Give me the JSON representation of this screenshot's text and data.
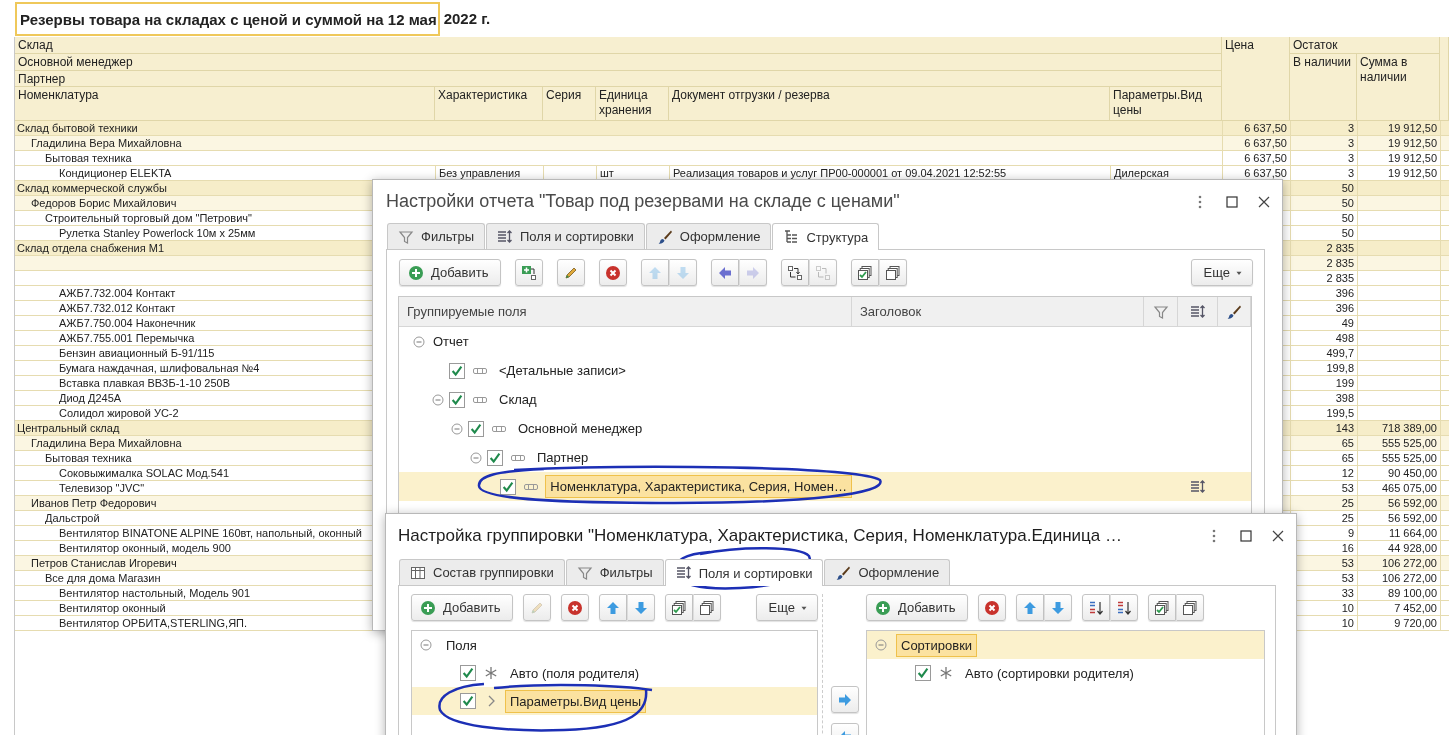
{
  "report": {
    "title_cell": "Резервы товара на складах с ценой и суммой на 12 мая",
    "title_rest": "2022 г.",
    "header": {
      "groupings": [
        "Склад",
        "Основной менеджер",
        "Партнер"
      ],
      "columns": [
        "Номенклатура",
        "Характеристика",
        "Серия",
        "Единица хранения",
        "Документ отгрузки / резерва",
        "Параметры.Вид цены"
      ],
      "price": "Цена",
      "balance": "Остаток",
      "balance_columns": [
        "В наличии",
        "Сумма в наличии"
      ]
    },
    "rows": [
      {
        "name": "Склад бытовой техники",
        "price": "6 637,50",
        "in_stock": "3",
        "sum": "19 912,50",
        "children": [
          {
            "name": "Гладилина Вера Михайловна",
            "price": "6 637,50",
            "in_stock": "3",
            "sum": "19 912,50",
            "children": [
              {
                "name": "Бытовая техника",
                "price": "6 637,50",
                "in_stock": "3",
                "sum": "19 912,50",
                "children": [
                  {
                    "name": "Кондиционер ELEKTA",
                    "characteristic": "Без управления",
                    "unit": "шт",
                    "document": "Реализация товаров и услуг ПР00-000001 от 09.04.2021 12:52:55",
                    "price_type": "Дилерская",
                    "price": "6 637,50",
                    "in_stock": "3",
                    "sum": "19 912,50"
                  }
                ]
              }
            ]
          }
        ]
      },
      {
        "name": "Склад коммерческой службы",
        "in_stock": "50",
        "children": [
          {
            "name": "Федоров Борис Михайлович",
            "in_stock": "50",
            "children": [
              {
                "name": "Строительный торговый дом \"Петрович\"",
                "in_stock": "50",
                "children": [
                  {
                    "name": "Рулетка Stanley Powerlock 10м x 25мм",
                    "in_stock": "50"
                  }
                ]
              }
            ]
          }
        ]
      },
      {
        "name": "Склад отдела снабжения М1",
        "in_stock": "2 835",
        "children": [
          {
            "in_stock": "2 835",
            "children": [
              {
                "in_stock": "2 835",
                "children": [
                  {
                    "name": "АЖБ7.732.004 Контакт",
                    "in_stock": "396"
                  },
                  {
                    "name": "АЖБ7.732.012 Контакт",
                    "in_stock": "396"
                  },
                  {
                    "name": "АЖБ7.750.004 Наконечник",
                    "in_stock": "49"
                  },
                  {
                    "name": "АЖБ7.755.001 Перемычка",
                    "in_stock": "498"
                  },
                  {
                    "name": "Бензин авиационный Б-91/115",
                    "in_stock": "499,7"
                  },
                  {
                    "name": "Бумага наждачная, шлифовальная №4",
                    "in_stock": "199,8"
                  },
                  {
                    "name": "Вставка плавкая ВВЗБ-1-10 250В",
                    "in_stock": "199"
                  },
                  {
                    "name": "Диод Д245А",
                    "in_stock": "398"
                  },
                  {
                    "name": "Солидол жировой УС-2",
                    "in_stock": "199,5"
                  }
                ]
              }
            ]
          }
        ]
      },
      {
        "name": "Центральный склад",
        "in_stock": "143",
        "sum": "718 389,00",
        "children": [
          {
            "name": "Гладилина Вера Михайловна",
            "in_stock": "65",
            "sum": "555 525,00",
            "children": [
              {
                "name": "Бытовая техника",
                "in_stock": "65",
                "sum": "555 525,00",
                "children": [
                  {
                    "name": "Соковыжималка  SOLAC  Мод.541",
                    "in_stock": "12",
                    "sum": "90 450,00"
                  },
                  {
                    "name": "Телевизор \"JVC\"",
                    "in_stock": "53",
                    "sum": "465 075,00"
                  }
                ]
              }
            ]
          },
          {
            "name": "Иванов Петр Федорович",
            "in_stock": "25",
            "sum": "56 592,00",
            "children": [
              {
                "name": "Дальстрой",
                "in_stock": "25",
                "sum": "56 592,00",
                "children": [
                  {
                    "name": "Вентилятор BINATONE ALPINE 160вт, напольный, оконный",
                    "in_stock": "9",
                    "sum": "11 664,00"
                  },
                  {
                    "name": "Вентилятор оконный, модель 900",
                    "in_stock": "16",
                    "sum": "44 928,00"
                  }
                ]
              }
            ]
          },
          {
            "name": "Петров Станислав Игоревич",
            "in_stock": "53",
            "sum": "106 272,00",
            "children": [
              {
                "name": "Все для дома Магазин",
                "in_stock": "53",
                "sum": "106 272,00",
                "children": [
                  {
                    "name": "Вентилятор настольный, Модель 901",
                    "in_stock": "33",
                    "sum": "89 100,00"
                  },
                  {
                    "name": "Вентилятор оконный",
                    "in_stock": "10",
                    "sum": "7 452,00"
                  },
                  {
                    "name": "Вентилятор ОРБИТА,STERLING,ЯП.",
                    "in_stock": "10",
                    "sum": "9 720,00"
                  }
                ]
              }
            ]
          }
        ]
      }
    ]
  },
  "settings_dialog": {
    "title": "Настройки отчета \"Товар под резервами на складе с ценами\"",
    "tabs": [
      {
        "label": "Фильтры",
        "selected": false
      },
      {
        "label": "Поля и сортировки",
        "selected": false
      },
      {
        "label": "Оформление",
        "selected": false
      },
      {
        "label": "Структура",
        "selected": true
      }
    ],
    "toolbar": {
      "add": "Добавить",
      "more": "Еще",
      "buttons": [
        {
          "disabled": false
        },
        {
          "disabled": false
        },
        {
          "disabled": false
        },
        {
          "disabled": true
        },
        {
          "disabled": true
        },
        {
          "disabled": false
        },
        {
          "disabled": true
        },
        {
          "disabled": false
        },
        {
          "disabled": true
        },
        {
          "disabled": false
        },
        {
          "disabled": false
        }
      ]
    },
    "columns": [
      "Группируемые поля",
      "Заголовок"
    ],
    "tree": [
      {
        "label": "Отчет",
        "expanded": true,
        "selected": false,
        "children": [
          {
            "label": "<Детальные записи>",
            "kind": "group",
            "checked": true,
            "selected": false,
            "sorted": false
          },
          {
            "label": "Склад",
            "kind": "group",
            "expanded": true,
            "checked": true,
            "selected": false,
            "sorted": false,
            "children": [
              {
                "label": "Основной менеджер",
                "kind": "group",
                "expanded": true,
                "checked": true,
                "selected": false,
                "sorted": false,
                "children": [
                  {
                    "label": "Партнер",
                    "kind": "group",
                    "expanded": true,
                    "checked": true,
                    "selected": false,
                    "sorted": false,
                    "children": [
                      {
                        "label": "Номенклатура, Характеристика, Серия, Номен…",
                        "kind": "group",
                        "checked": true,
                        "selected": true,
                        "sorted": true
                      }
                    ]
                  }
                ]
              }
            ]
          }
        ]
      }
    ]
  },
  "grouping_dialog": {
    "title": "Настройка группировки \"Номенклатура, Характеристика, Серия, Номенклатура.Единица …",
    "tabs": [
      {
        "label": "Состав группировки",
        "selected": false
      },
      {
        "label": "Фильтры",
        "selected": false
      },
      {
        "label": "Поля и сортировки",
        "selected": true
      },
      {
        "label": "Оформление",
        "selected": false
      }
    ],
    "fields": {
      "toolbar": {
        "add": "Добавить",
        "more": "Еще",
        "buttons": [
          {
            "disabled": true
          },
          {
            "disabled": false
          },
          {
            "disabled": false
          },
          {
            "disabled": false
          },
          {
            "disabled": false
          },
          {
            "disabled": false
          }
        ]
      },
      "tree": [
        {
          "label": "Поля",
          "expanded": true,
          "selected": false,
          "children": [
            {
              "label": "Авто (поля родителя)",
              "kind": "auto",
              "checked": true,
              "selected": false
            },
            {
              "label": "Параметры.Вид цены",
              "kind": "field",
              "checked": true,
              "selected": true
            }
          ]
        }
      ]
    },
    "move_buttons": [
      {
        "disabled": false
      },
      {
        "disabled": false
      }
    ],
    "sorting": {
      "toolbar": {
        "add": "Добавить",
        "buttons": [
          {
            "disabled": false
          },
          {
            "disabled": false
          },
          {
            "disabled": false
          },
          {
            "disabled": false
          },
          {
            "disabled": false
          },
          {
            "disabled": false
          },
          {
            "disabled": false
          }
        ]
      },
      "tree": [
        {
          "label": "Сортировки",
          "expanded": true,
          "selected": true,
          "children": [
            {
              "label": "Авто (сортировки родителя)",
              "kind": "auto",
              "checked": true,
              "selected": false
            }
          ]
        }
      ]
    }
  }
}
